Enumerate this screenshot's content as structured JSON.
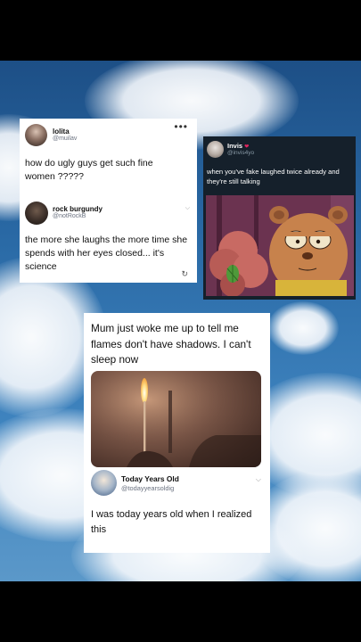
{
  "tweet1": {
    "name": "lolita",
    "handle": "@muilav",
    "more": "•••",
    "text": "how do ugly guys get such fine women ?????",
    "reply": {
      "name": "rock burgundy",
      "handle": "@notRockB",
      "text": "the more she laughs the more time she spends with her eyes closed...  it's science"
    }
  },
  "tweet2": {
    "name": "Invis",
    "handle": "@invis4yo",
    "text": "when you've fake laughed twice already and they're still talking"
  },
  "tweet3": {
    "text": "Mum just woke me up to tell me flames don't have shadows. I can't sleep now",
    "reply": {
      "name": "Today Years Old",
      "handle": "@todayyearsoldig",
      "text": "I was today years old when I realized this"
    }
  },
  "colors": {
    "sky": "#2a6aa6",
    "dark_card": "#15202b",
    "cartoon_bg": "#6b3350"
  }
}
